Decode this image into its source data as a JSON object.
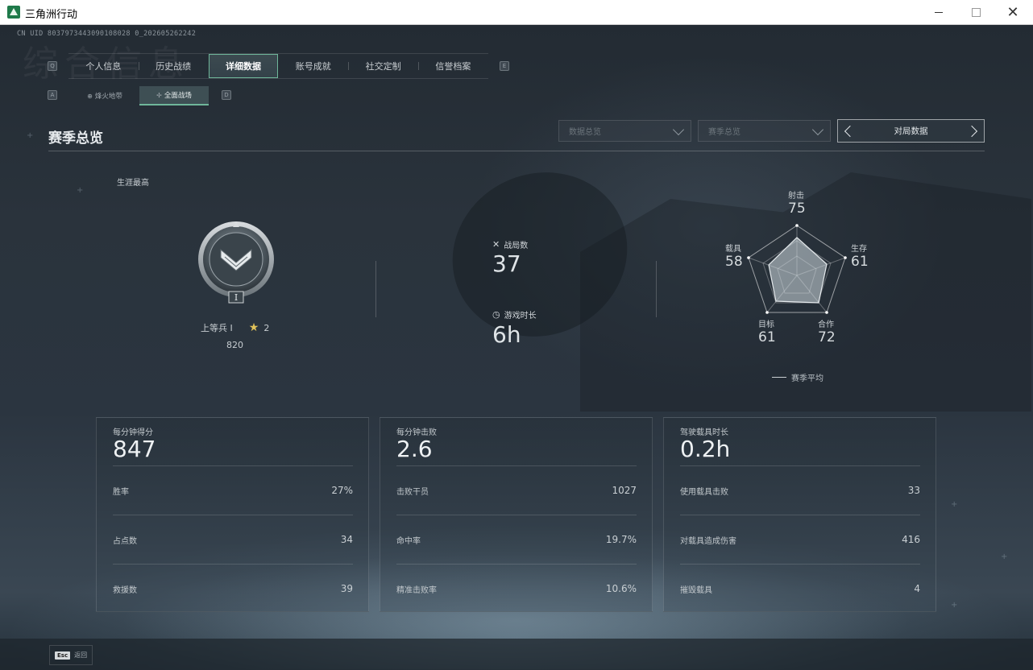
{
  "window": {
    "title": "三角洲行动",
    "accent_color": "#1f7a4a"
  },
  "header": {
    "uid": "CN UID 8037973443090108028 0_202605262242",
    "bg_title": "综合信息"
  },
  "tabs": {
    "prev_key": "Q",
    "next_key": "E",
    "items": [
      {
        "label": "个人信息"
      },
      {
        "label": "历史战绩"
      },
      {
        "label": "详细数据",
        "active": true
      },
      {
        "label": "账号成就"
      },
      {
        "label": "社交定制"
      },
      {
        "label": "信誉档案"
      }
    ],
    "active_color": "#6fb69a"
  },
  "subtabs": {
    "prev_key": "A",
    "next_key": "D",
    "items": [
      {
        "label": "烽火地带",
        "icon": "operations-icon"
      },
      {
        "label": "全面战场",
        "icon": "warfare-icon",
        "active": true
      }
    ]
  },
  "section": {
    "title": "赛季总览"
  },
  "filters": {
    "dropdown1": "数据总览",
    "dropdown2": "赛季总览",
    "stepper": "对局数据"
  },
  "career": {
    "label": "生涯最高",
    "rank_name": "上等兵 I",
    "stars": "2",
    "score": "820",
    "badge_numeral": "I"
  },
  "center": {
    "matches_label": "战局数",
    "matches_value": "37",
    "time_label": "游戏时长",
    "time_value": "6h"
  },
  "radar": {
    "axes": [
      {
        "label": "射击",
        "value": "75"
      },
      {
        "label": "生存",
        "value": "61"
      },
      {
        "label": "合作",
        "value": "72"
      },
      {
        "label": "目标",
        "value": "61"
      },
      {
        "label": "载具",
        "value": "58"
      }
    ],
    "legend": "赛季平均"
  },
  "cards": [
    {
      "head_label": "每分钟得分",
      "head_value": "847",
      "rows": [
        {
          "label": "胜率",
          "value": "27%"
        },
        {
          "label": "占点数",
          "value": "34"
        },
        {
          "label": "救援数",
          "value": "39"
        }
      ]
    },
    {
      "head_label": "每分钟击败",
      "head_value": "2.6",
      "rows": [
        {
          "label": "击败干员",
          "value": "1027"
        },
        {
          "label": "命中率",
          "value": "19.7%"
        },
        {
          "label": "精准击败率",
          "value": "10.6%"
        }
      ]
    },
    {
      "head_label": "驾驶载具时长",
      "head_value": "0.2h",
      "rows": [
        {
          "label": "使用载具击败",
          "value": "33"
        },
        {
          "label": "对载具造成伤害",
          "value": "416"
        },
        {
          "label": "摧毁载具",
          "value": "4"
        }
      ]
    }
  ],
  "footer": {
    "esc_key": "Esc",
    "esc_label": "返回"
  }
}
